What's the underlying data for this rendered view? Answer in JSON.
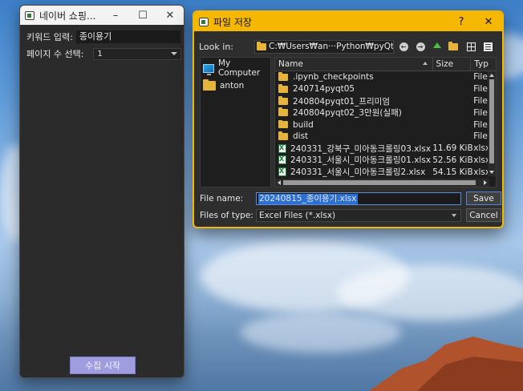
{
  "main_window": {
    "title": "네이버 쇼핑...",
    "keyword_label": "키워드 입력:",
    "keyword_value": "종이용기",
    "pages_label": "페이지 수 선택:",
    "pages_value": "1",
    "start_button": "수집 시작"
  },
  "dialog": {
    "title": "파일 저장",
    "help": "?",
    "close": "✕",
    "look_in_label": "Look in:",
    "path": "C:₩Users₩an···Python₩pyQt",
    "sidebar": [
      {
        "label": "My Computer",
        "icon": "computer-icon"
      },
      {
        "label": "anton",
        "icon": "folder-icon"
      }
    ],
    "columns": {
      "name": "Name",
      "size": "Size",
      "type": "Typ"
    },
    "files": [
      {
        "name": ".ipynb_checkpoints",
        "size": "",
        "type": "File",
        "icon": "folder"
      },
      {
        "name": "240714pyqt05",
        "size": "",
        "type": "File",
        "icon": "folder"
      },
      {
        "name": "240804pyqt01_프리미엄",
        "size": "",
        "type": "File",
        "icon": "folder"
      },
      {
        "name": "240804pyqt02_3만원(실패)",
        "size": "",
        "type": "File",
        "icon": "folder"
      },
      {
        "name": "build",
        "size": "",
        "type": "File",
        "icon": "folder"
      },
      {
        "name": "dist",
        "size": "",
        "type": "File",
        "icon": "folder"
      },
      {
        "name": "240331_강북구_미아동크롤링03.xlsx",
        "size": "11.69 KiB",
        "type": "xlsx",
        "icon": "xlsx"
      },
      {
        "name": "240331_서울시_미아동크롤링01.xlsx",
        "size": "52.56 KiB",
        "type": "xlsx",
        "icon": "xlsx"
      },
      {
        "name": "240331_서울시_미아동크롤링2.xlsx",
        "size": "54.15 KiB",
        "type": "xlsx",
        "icon": "xlsx"
      }
    ],
    "file_name_label": "File name:",
    "file_name_value": "20240815_종이용기.xlsx",
    "file_type_label": "Files of type:",
    "file_type_value": "Excel Files (*.xlsx)",
    "save_button": "Save",
    "cancel_button": "Cancel"
  }
}
